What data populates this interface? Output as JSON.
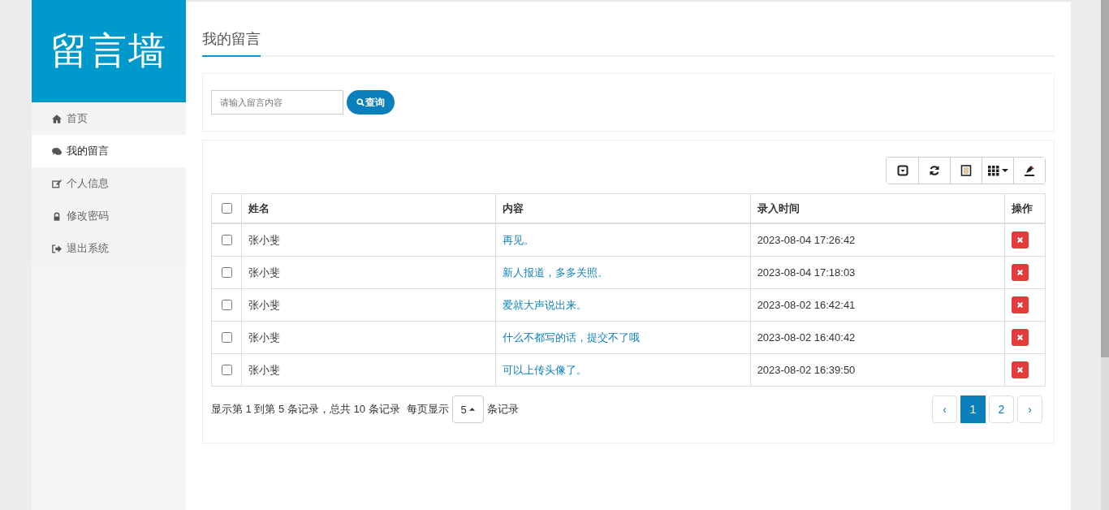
{
  "sidebar": {
    "logo": "留言墙",
    "items": [
      {
        "label": "首页",
        "selected": false
      },
      {
        "label": "我的留言",
        "selected": true
      },
      {
        "label": "个人信息",
        "selected": false
      },
      {
        "label": "修改密码",
        "selected": false
      },
      {
        "label": "退出系统",
        "selected": false
      }
    ]
  },
  "page_title": "我的留言",
  "search": {
    "placeholder": "请输入留言内容",
    "button": "查询"
  },
  "table": {
    "select_all_checked": false,
    "columns": [
      "姓名",
      "内容",
      "录入时间",
      "操作"
    ],
    "rows": [
      {
        "checked": false,
        "name": "张小斐",
        "content": "再见。",
        "time": "2023-08-04 17:26:42"
      },
      {
        "checked": false,
        "name": "张小斐",
        "content": "新人报道，多多关照。",
        "time": "2023-08-04 17:18:03"
      },
      {
        "checked": false,
        "name": "张小斐",
        "content": "爱就大声说出来。",
        "time": "2023-08-02 16:42:41"
      },
      {
        "checked": false,
        "name": "张小斐",
        "content": "什么不都写的话，提交不了哦",
        "time": "2023-08-02 16:40:42"
      },
      {
        "checked": false,
        "name": "张小斐",
        "content": "可以上传头像了。",
        "time": "2023-08-02 16:39:50"
      }
    ]
  },
  "pagination": {
    "summary": "显示第 1 到第 5 条记录，总共 10 条记录",
    "per_page_label": "每页显示",
    "per_page": "5",
    "per_page_suffix": "条记录",
    "prev": "‹",
    "next": "›",
    "pages": [
      {
        "label": "1",
        "selected": true
      },
      {
        "label": "2",
        "selected": false
      }
    ]
  }
}
